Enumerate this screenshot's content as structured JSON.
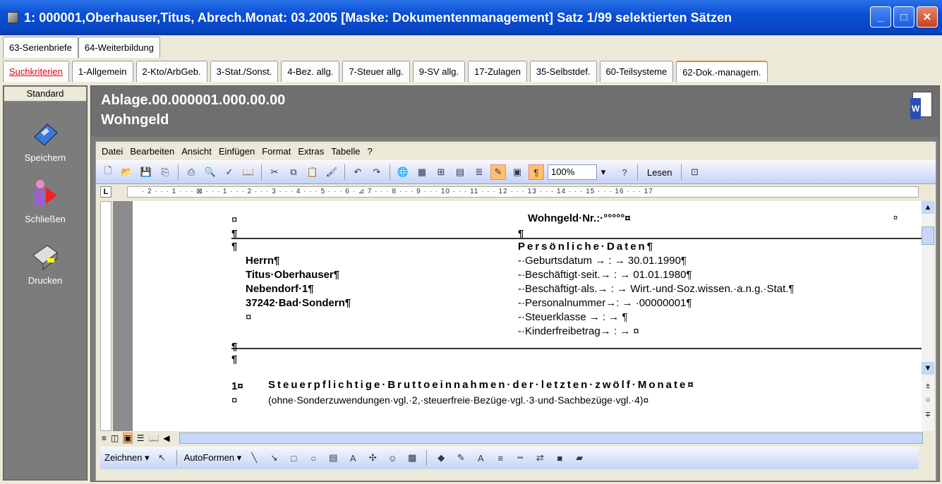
{
  "window": {
    "title": "1: 000001,Oberhauser,Titus, Abrech.Monat: 03.2005   [Maske: Dokumentenmanagement]   Satz 1/99 selektierten Sätzen"
  },
  "tabs_row1": [
    "63-Serienbriefe",
    "64-Weiterbildung"
  ],
  "tabs_row2": [
    "Suchkriterien",
    "1-Allgemein",
    "2-Kto/ArbGeb.",
    "3-Stat./Sonst.",
    "4-Bez. allg.",
    "7-Steuer allg.",
    "9-SV allg.",
    "17-Zulagen",
    "35-Selbstdef.",
    "60-Teilsysteme",
    "62-Dok.-managem."
  ],
  "left": {
    "standard": "Standard",
    "save": "Speichern",
    "close": "Schließen",
    "print": "Drucken"
  },
  "header": {
    "line1": "Ablage.00.000001.000.00.00",
    "line2": "Wohngeld"
  },
  "menu": [
    "Datei",
    "Bearbeiten",
    "Ansicht",
    "Einfügen",
    "Format",
    "Extras",
    "Tabelle",
    "?"
  ],
  "toolbar": {
    "zoom": "100%",
    "read": "Lesen"
  },
  "ruler": "· 2 · · · 1 · · · ⊠ · · · 1 · · · 2 · · · 3 · · · 4 · · · 5 · · · 6 · ⊿ 7 · · · 8 · · · 9 · · · 10 · · · 11 · · · 12 · · · 13 · · · 14 · · · 15 · · · 16 · · · 17",
  "doc": {
    "wohngeld_nr": "Wohngeld·Nr.:·°°°°°¤",
    "section": "Persönliche·Daten¶",
    "herrn": "Herrn¶",
    "name": "Titus·Oberhauser¶",
    "street": "Nebendorf·1¶",
    "city": "37242·Bad·Sondern¶",
    "geb": "-·Geburtsdatum → : → 30.01.1990¶",
    "seit": "-·Beschäftigt·seit.→ : → 01.01.1980¶",
    "als": "-·Beschäftigt·als.→ : → Wirt.-und·Soz.wissen.·a.n.g.·Stat.¶",
    "pnr": "-·Personalnummer→: → ·00000001¶",
    "stkl": "-·Steuerklasse → : → ¶",
    "kinder": "-·Kinderfreibetrag→ : → ¤",
    "row1_num": "1¤",
    "row1_title": "Steuerpflichtige·Bruttoeinnahmen·der·letzten·zwölf·Monate¤",
    "row1_sub": "(ohne·Sonderzuwendungen·vgl.·2,·steuerfreie·Bezüge·vgl.·3·und·Sachbezüge·vgl.·4)¤",
    "pil": "¶",
    "cur": "¤"
  },
  "draw": {
    "draw": "Zeichnen ▾",
    "autoshapes": "AutoFormen ▾"
  }
}
